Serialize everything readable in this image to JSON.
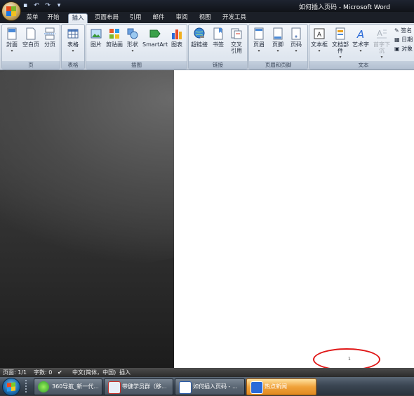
{
  "window": {
    "title_doc": "如何插入页码",
    "title_sep": " - ",
    "title_app": "Microsoft Word"
  },
  "quick_access": [
    "save-icon",
    "undo-icon",
    "redo-icon",
    "customize-icon"
  ],
  "tabs": [
    {
      "label": "菜单"
    },
    {
      "label": "开始"
    },
    {
      "label": "插入",
      "active": true
    },
    {
      "label": "页面布局"
    },
    {
      "label": "引用"
    },
    {
      "label": "邮件"
    },
    {
      "label": "审阅"
    },
    {
      "label": "视图"
    },
    {
      "label": "开发工具"
    }
  ],
  "ribbon": {
    "groups": [
      {
        "label": "页",
        "buttons": [
          "封面",
          "空白页",
          "分页"
        ]
      },
      {
        "label": "表格",
        "buttons": [
          "表格"
        ]
      },
      {
        "label": "插图",
        "buttons": [
          "图片",
          "剪贴画",
          "形状",
          "SmartArt",
          "图表"
        ]
      },
      {
        "label": "链接",
        "buttons": [
          "超链接",
          "书签",
          "交叉",
          "引用"
        ]
      },
      {
        "label": "页眉和页脚",
        "buttons": [
          "页眉",
          "页脚",
          "页码"
        ]
      },
      {
        "label": "文本",
        "buttons": [
          "文本框",
          "文档部件",
          "艺术字",
          "首字下沉"
        ],
        "small": [
          "签名",
          "日期",
          "对象"
        ]
      }
    ]
  },
  "document": {
    "footer_page_number": "1"
  },
  "statusbar": {
    "page": "页面: 1/1",
    "words": "字数: 0",
    "language": "中文(简体，中国)",
    "mode": "插入"
  },
  "taskbar": {
    "items": [
      {
        "label": "360导航_新一代..."
      },
      {
        "label": "带健学员群（移..."
      },
      {
        "label": "如何插入页码 - ..."
      },
      {
        "label": "热点新闻",
        "active": true
      }
    ]
  },
  "colors": {
    "annotation_circle": "#e01818",
    "active_task": "#f0a23a"
  }
}
